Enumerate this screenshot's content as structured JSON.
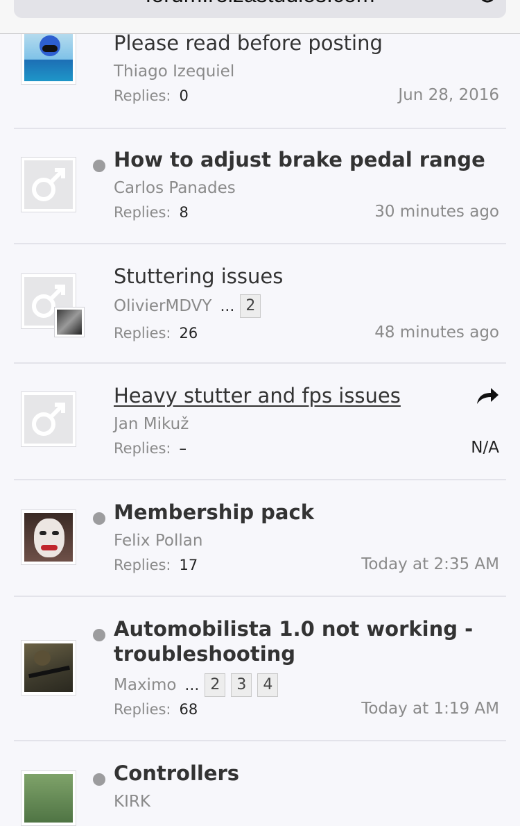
{
  "browser": {
    "url": "forum.reizastudios.com"
  },
  "labels": {
    "replies": "Replies:"
  },
  "threads": [
    {
      "title": "Please read before posting",
      "author": "Thiago Izequiel",
      "replies": "0",
      "date": "Jun 28, 2016"
    },
    {
      "title": "How to adjust brake pedal range",
      "author": "Carlos Panades",
      "replies": "8",
      "date": "30 minutes ago"
    },
    {
      "title": "Stuttering issues",
      "author": "OlivierMDVY",
      "ellipsis": "...",
      "pages": [
        "2"
      ],
      "replies": "26",
      "date": "48 minutes ago"
    },
    {
      "title": "Heavy stutter and fps issues",
      "author": "Jan Mikuž",
      "replies": "–",
      "date": "N/A"
    },
    {
      "title": "Membership pack",
      "author": "Felix Pollan",
      "replies": "17",
      "date": "Today at 2:35 AM"
    },
    {
      "title_line1": "Automobilista 1.0 not working -",
      "title_line2": "troubleshooting",
      "author": "Maximo",
      "ellipsis": "...",
      "pages": [
        "2",
        "3",
        "4"
      ],
      "replies": "68",
      "date": "Today at 1:19 AM"
    },
    {
      "title": "Controllers",
      "author": "KIRK"
    }
  ]
}
